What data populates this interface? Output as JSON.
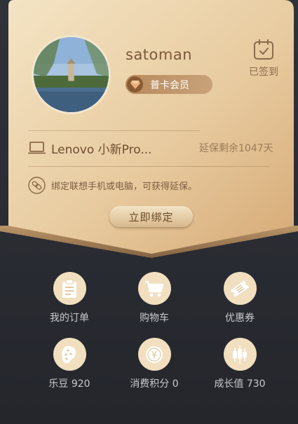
{
  "user": {
    "name": "satoman",
    "member_level": "普卡会员"
  },
  "checkin": {
    "label": "已签到"
  },
  "device": {
    "name": "Lenovo 小新Pro...",
    "warranty": "延保剩余1047天"
  },
  "bind": {
    "hint": "绑定联想手机或电脑，可获得延保。",
    "button_label": "立即绑定"
  },
  "grid": {
    "orders": {
      "label": "我的订单",
      "icon": "clipboard-icon"
    },
    "cart": {
      "label": "购物车",
      "icon": "cart-icon"
    },
    "coupons": {
      "label": "优惠券",
      "icon": "ticket-icon"
    },
    "ledou": {
      "label": "乐豆 920",
      "icon": "bean-icon"
    },
    "points": {
      "label": "消费积分 0",
      "icon": "yen-coin-icon"
    },
    "growth": {
      "label": "成长值 730",
      "icon": "candlestick-icon"
    }
  },
  "colors": {
    "gold_light": "#f3e3c3",
    "gold_dark": "#d9b17f",
    "dark_bg": "#2b2d34"
  }
}
